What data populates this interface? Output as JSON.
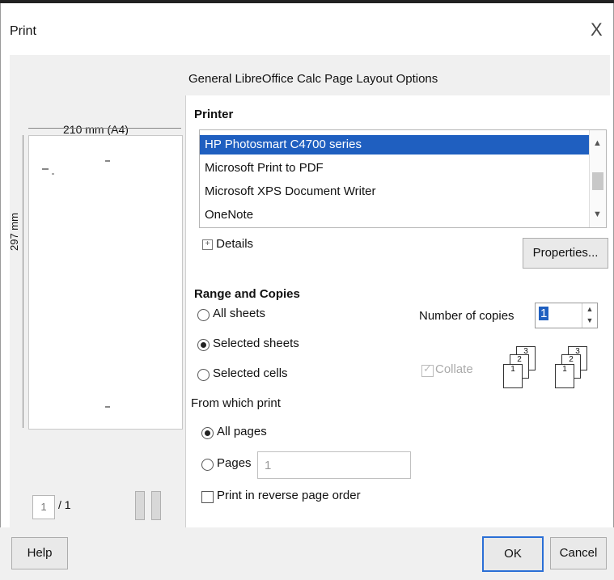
{
  "window": {
    "title": "Print",
    "close_glyph": "X"
  },
  "tabs": [
    "General",
    "LibreOffice Calc",
    "Page Layout",
    "Options"
  ],
  "printer": {
    "heading": "Printer",
    "items": [
      "HP Photosmart C4700 series",
      "Microsoft Print to PDF",
      "Microsoft XPS Document Writer",
      "OneNote"
    ],
    "selected_index": 0,
    "details_label": "Details",
    "properties_label": "Properties..."
  },
  "range": {
    "heading": "Range and Copies",
    "options": [
      {
        "label": "All sheets",
        "checked": false
      },
      {
        "label": "Selected sheets",
        "checked": true
      },
      {
        "label": "Selected cells",
        "checked": false
      }
    ],
    "from_heading": "From which print",
    "all_pages_label": "All pages",
    "pages_label": "Pages",
    "pages_value": "1",
    "reverse_label": "Print in reverse page order",
    "copies_label": "Number of copies",
    "copies_value": "1",
    "collate_label": "Collate"
  },
  "preview": {
    "width_label": "210 mm (A4)",
    "height_label": "297 mm",
    "page_current": "1",
    "page_total": "/ 1"
  },
  "footer": {
    "help": "Help",
    "ok": "OK",
    "cancel": "Cancel"
  },
  "colors": {
    "selection": "#1f5fc0",
    "dialog_bg": "#f0f0f0"
  }
}
